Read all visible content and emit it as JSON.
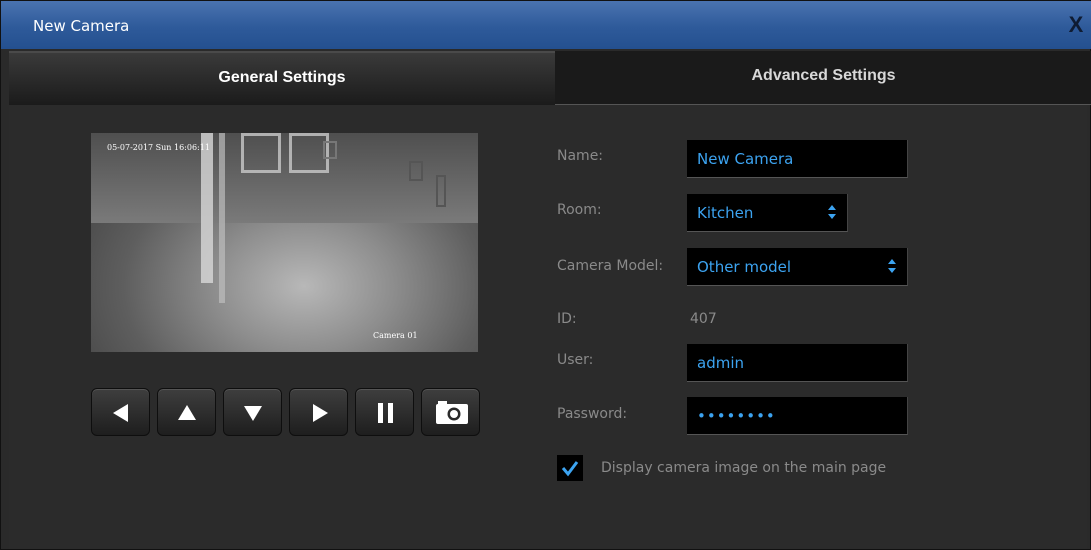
{
  "window": {
    "title": "New Camera",
    "close_label": "X"
  },
  "tabs": [
    {
      "label": "General Settings"
    },
    {
      "label": "Advanced Settings"
    }
  ],
  "preview": {
    "timestamp": "05-07-2017 Sun 16:06:11",
    "camera_label": "Camera 01"
  },
  "ptz_controls": [
    "left-arrow-icon",
    "up-arrow-icon",
    "down-arrow-icon",
    "right-arrow-icon",
    "pause-icon",
    "camera-icon"
  ],
  "form": {
    "name_label": "Name:",
    "name_value": "New Camera",
    "room_label": "Room:",
    "room_value": "Kitchen",
    "model_label": "Camera Model:",
    "model_value": "Other model",
    "id_label": "ID:",
    "id_value": "407",
    "user_label": "User:",
    "user_value": "admin",
    "password_label": "Password:",
    "password_value": "••••••••",
    "display_checkbox_label": "Display camera image on the main page",
    "display_checkbox_checked": true
  },
  "colors": {
    "accent": "#3ca3f0",
    "titlebar": "#2e5a9a",
    "background": "#2a2a2a"
  }
}
